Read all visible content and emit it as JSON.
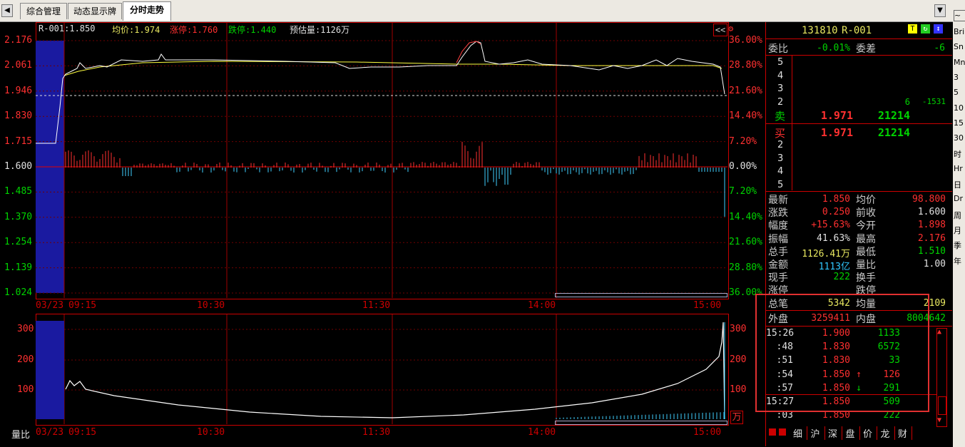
{
  "tabs": [
    "综合管理",
    "动态显示牌",
    "分时走势"
  ],
  "header": {
    "name_price": "R-001:1.850",
    "avg": "均价:1.974",
    "up": "涨停:1.760",
    "down": "跌停:1.440",
    "est": "预估量:1126万"
  },
  "price_axis": {
    "left": [
      "2.176",
      "2.061",
      "1.946",
      "1.830",
      "1.715",
      "1.600",
      "1.485",
      "1.370",
      "1.254",
      "1.139",
      "1.024"
    ],
    "right": [
      "36.00%",
      "28.80%",
      "21.60%",
      "14.40%",
      "7.20%",
      "0.00%",
      "7.20%",
      "14.40%",
      "21.60%",
      "28.80%",
      "36.00%"
    ]
  },
  "time_labels": [
    "03/23",
    "09:15",
    "10:30",
    "11:30",
    "14:00",
    "15:00"
  ],
  "vol_axis": {
    "left": [
      "300",
      "200",
      "100"
    ],
    "right": [
      "300",
      "200",
      "100"
    ],
    "unit": "万",
    "label": "量比"
  },
  "panel": {
    "code": "131810",
    "name": "R-001",
    "icons": [
      "T",
      "↻",
      "↕"
    ],
    "weibi_label": "委比",
    "weibi": "-0.01%",
    "weicha_label": "委差",
    "weicha": "-6",
    "sell_levels": [
      "5",
      "4",
      "3",
      "2"
    ],
    "sell2_vol": "6",
    "sell2_diff": "-1531",
    "sell1_label": "卖",
    "sell1_price": "1.971",
    "sell1_vol": "21214",
    "buy1_label": "买",
    "buy1_price": "1.971",
    "buy1_vol": "21214",
    "buy_levels": [
      "2",
      "3",
      "4",
      "5"
    ],
    "stats": [
      {
        "l1": "最新",
        "v1": "1.850",
        "c1": "red",
        "l2": "均价",
        "v2": "98.800",
        "c2": "red"
      },
      {
        "l1": "涨跌",
        "v1": "0.250",
        "c1": "red",
        "l2": "前收",
        "v2": "1.600",
        "c2": "white"
      },
      {
        "l1": "幅度",
        "v1": "+15.63%",
        "c1": "red",
        "l2": "今开",
        "v2": "1.898",
        "c2": "red"
      },
      {
        "l1": "振幅",
        "v1": "41.63%",
        "c1": "white",
        "l2": "最高",
        "v2": "2.176",
        "c2": "red"
      },
      {
        "l1": "总手",
        "v1": "1126.41万",
        "c1": "yellow",
        "l2": "最低",
        "v2": "1.510",
        "c2": "green"
      },
      {
        "l1": "金额",
        "v1": "1113亿",
        "c1": "cyan",
        "l2": "量比",
        "v2": "1.00",
        "c2": "white"
      },
      {
        "l1": "现手",
        "v1": "222",
        "c1": "green",
        "l2": "换手",
        "v2": "",
        "c2": "white"
      },
      {
        "l1": "涨停",
        "v1": "",
        "c1": "white",
        "l2": "跌停",
        "v2": "",
        "c2": "white"
      }
    ],
    "total_trades_label": "总笔",
    "total_trades": "5342",
    "avg_vol_label": "均量",
    "avg_vol": "2109",
    "outer_label": "外盘",
    "outer": "3259411",
    "inner_label": "内盘",
    "inner": "8004642",
    "ticks": [
      {
        "t": "15:26",
        "p": "1.900",
        "pc": "red",
        "a": "",
        "v": "1133",
        "vc": "green"
      },
      {
        "t": ":48",
        "p": "1.830",
        "pc": "red",
        "a": "",
        "v": "6572",
        "vc": "green"
      },
      {
        "t": ":51",
        "p": "1.830",
        "pc": "red",
        "a": "",
        "v": "33",
        "vc": "green"
      },
      {
        "t": ":54",
        "p": "1.850",
        "pc": "red",
        "a": "↑",
        "v": "126",
        "vc": "red"
      },
      {
        "t": ":57",
        "p": "1.850",
        "pc": "red",
        "a": "↓",
        "v": "291",
        "vc": "green"
      },
      {
        "t": "15:27",
        "p": "1.850",
        "pc": "red",
        "a": "",
        "v": "509",
        "vc": "green"
      },
      {
        "t": ":03",
        "p": "1.850",
        "pc": "red",
        "a": "",
        "v": "222",
        "vc": "green"
      }
    ],
    "bottom_tabs": [
      "细",
      "沪",
      "深",
      "盘",
      "价",
      "龙",
      "财"
    ]
  },
  "right_strip": [
    "Bri",
    "Sn",
    "Mn",
    "3",
    "5",
    "10",
    "15",
    "30",
    "时",
    "Hr",
    "日",
    "Dr",
    "周",
    "月",
    "季",
    "年"
  ],
  "colors": {
    "price_line": "#ffffff",
    "avg_line": "#ffff40",
    "grid": "#a00000",
    "highlight_box": "#e03030"
  }
}
